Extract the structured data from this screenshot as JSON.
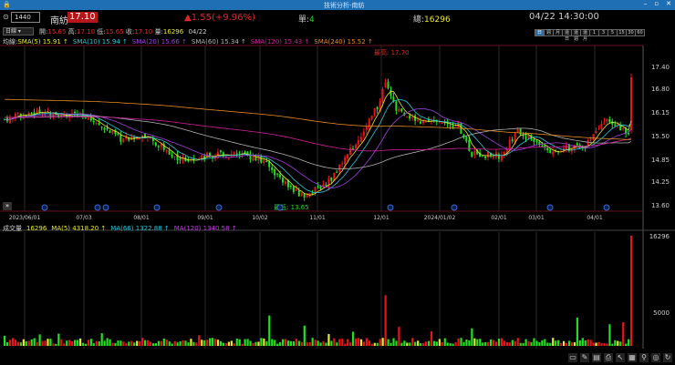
{
  "window": {
    "title": "技術分析-南紡",
    "controls": [
      "–",
      "▫",
      "✕"
    ]
  },
  "header": {
    "code": "1440",
    "name": "南紡",
    "price": "17.10",
    "change": "▲1.55(+9.96%)",
    "unit_label": "單:",
    "unit_value": "4",
    "total_label": "總:",
    "total_value": "16296",
    "datetime": "04/22 14:30:00"
  },
  "ohlc": {
    "period": "日線",
    "open_label": "開:",
    "open": "15.65",
    "high_label": "高:",
    "high": "17.10",
    "low_label": "低:",
    "low": "15.65",
    "close_label": "收:",
    "close": "17.10",
    "vol_label": "量:",
    "volume": "16296",
    "date": "04/22"
  },
  "periods": [
    "日",
    "週",
    "月",
    "還日",
    "還週",
    "還月",
    "1",
    "3",
    "5",
    "15",
    "30",
    "60"
  ],
  "ma_legend": {
    "label": "均線:",
    "items": [
      {
        "text": "SMA(5) 15.91 ↑",
        "color": "#e8e830"
      },
      {
        "text": "SMA(10) 15.94 ↑",
        "color": "#28c8d8"
      },
      {
        "text": "SMA(20) 15.66 ↑",
        "color": "#a040e0"
      },
      {
        "text": "SMA(60) 15.34 ↑",
        "color": "#b0b0b0"
      },
      {
        "text": "SMA(120) 15.43 ↑",
        "color": "#d0209a"
      },
      {
        "text": "SMA(240) 15.52 ↑",
        "color": "#e88a20"
      }
    ]
  },
  "annotations": {
    "high": "最高: 17.70",
    "low": "最低: 13.65"
  },
  "price_axis": [
    "17.40",
    "16.80",
    "16.15",
    "15.50",
    "14.85",
    "14.25",
    "13.60"
  ],
  "date_axis": [
    "2023/06/01",
    "07/03",
    "08/01",
    "09/01",
    "10/02",
    "11/01",
    "12/01",
    "2024/01/02",
    "02/01",
    "03/01",
    "04/01"
  ],
  "volume_legend": {
    "label": "成交量",
    "value": "16296",
    "items": [
      {
        "text": "MA(5) 4318.20 ↑",
        "color": "#e8e830"
      },
      {
        "text": "MA(66) 1322.88 ↑",
        "color": "#28c8d8"
      },
      {
        "text": "MA(120) 1340.58 ↑",
        "color": "#c040e0"
      }
    ]
  },
  "volume_axis": [
    "16296",
    "5000"
  ],
  "chart_data": {
    "type": "candlestick",
    "price_ylim": [
      13.6,
      17.4
    ],
    "price_path": [
      [
        0,
        15.95
      ],
      [
        12,
        16.15
      ],
      [
        30,
        16.05
      ],
      [
        43,
        15.4
      ],
      [
        53,
        15.45
      ],
      [
        65,
        14.85
      ],
      [
        80,
        15.0
      ],
      [
        94,
        14.9
      ],
      [
        107,
        14.0
      ],
      [
        111,
        13.8
      ],
      [
        121,
        14.3
      ],
      [
        130,
        15.3
      ],
      [
        138,
        16.3
      ],
      [
        141,
        16.9
      ],
      [
        145,
        16.2
      ],
      [
        155,
        15.85
      ],
      [
        168,
        15.8
      ],
      [
        173,
        15.0
      ],
      [
        183,
        14.95
      ],
      [
        190,
        15.6
      ],
      [
        202,
        15.1
      ],
      [
        215,
        15.2
      ],
      [
        223,
        16.0
      ],
      [
        231,
        15.55
      ],
      [
        232,
        17.1
      ]
    ],
    "volume_spikes": [
      [
        0,
        1500
      ],
      [
        98,
        4500
      ],
      [
        111,
        3000
      ],
      [
        141,
        7500
      ],
      [
        146,
        2800
      ],
      [
        173,
        2600
      ],
      [
        212,
        4200
      ],
      [
        224,
        3200
      ],
      [
        229,
        3500
      ],
      [
        232,
        16296
      ]
    ],
    "volume_ylim": [
      0,
      16296
    ]
  },
  "toolbar": [
    "▭",
    "✎",
    "▤",
    "⎙",
    "↖",
    "▦",
    "⚲",
    "◎",
    "↻",
    "−",
    "+"
  ]
}
